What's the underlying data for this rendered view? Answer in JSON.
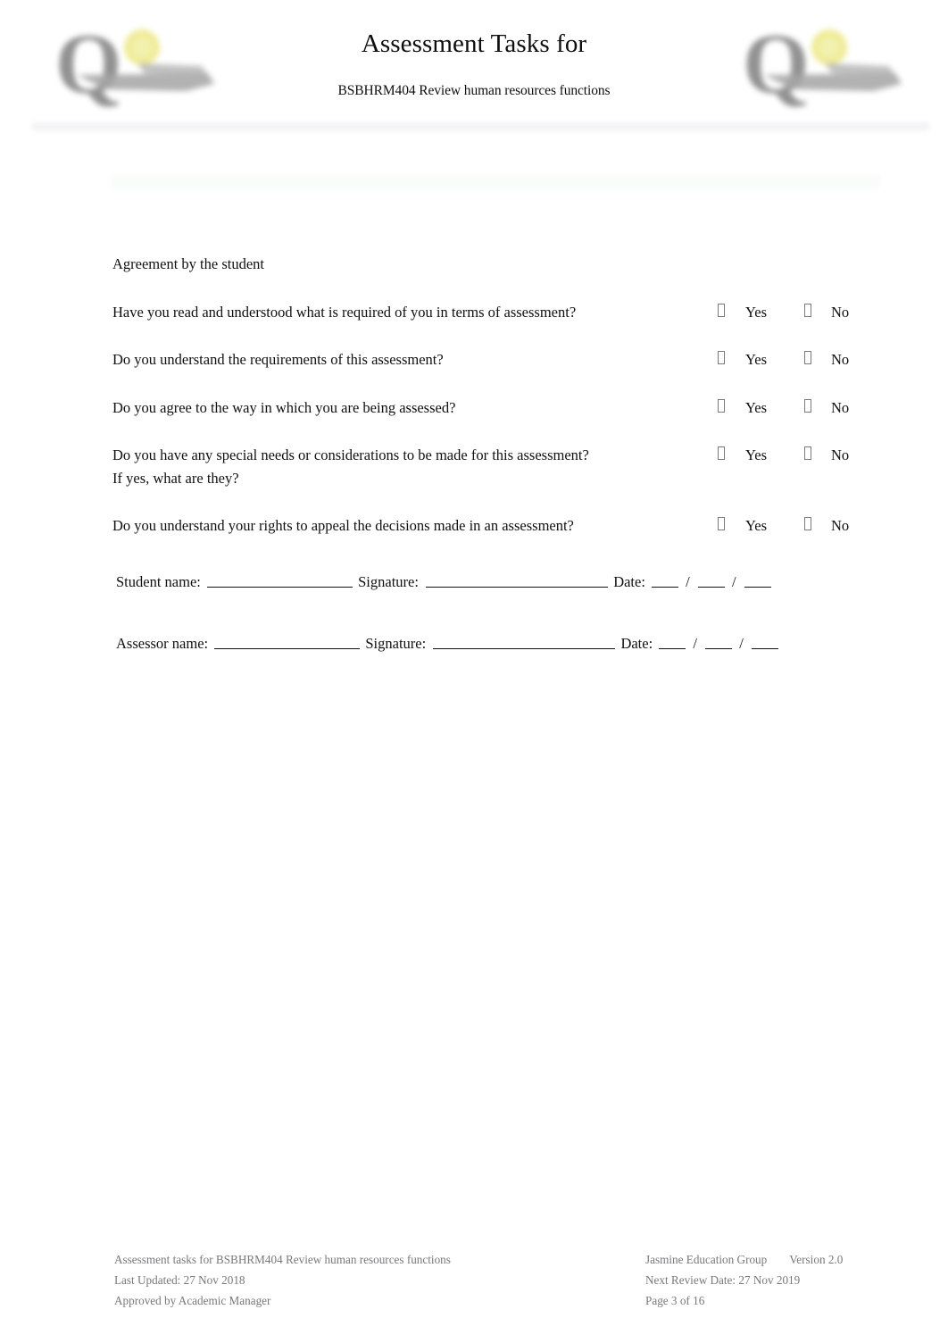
{
  "header": {
    "title": "Assessment Tasks for",
    "subtitle": "BSBHRM404 Review human resources functions",
    "logo_left_name": "jasmine-education-q-logo",
    "logo_right_name": "jasmine-education-q-logo"
  },
  "body": {
    "section_heading": "Agreement by the student",
    "questions": [
      {
        "line1": "Have you read and understood what is required of you in terms of assessment?",
        "line2": "",
        "yes_label": "Yes",
        "no_label": "No"
      },
      {
        "line1": "Do you understand the requirements of this assessment?",
        "line2": "",
        "yes_label": "Yes",
        "no_label": "No"
      },
      {
        "line1": "Do you agree to the way in which you are being assessed?",
        "line2": "",
        "yes_label": "Yes",
        "no_label": "No"
      },
      {
        "line1": "Do you have any special needs or considerations to be made for this assessment?",
        "line2": "If yes, what are they?",
        "yes_label": "Yes",
        "no_label": "No"
      },
      {
        "line1": "Do you understand your rights to appeal the decisions made in an assessment?",
        "line2": "",
        "yes_label": "Yes",
        "no_label": "No"
      }
    ],
    "signatures": [
      {
        "name_label": "Student name:",
        "signature_label": "Signature:",
        "date_label": "Date:",
        "date_separator": "/"
      },
      {
        "name_label": "Assessor name:",
        "signature_label": "Signature:",
        "date_label": "Date:",
        "date_separator": "/"
      }
    ]
  },
  "footer": {
    "left_line1": "Assessment tasks for  BSBHRM404 Review human resources functions",
    "left_line2": "Last Updated: 27 Nov 2018",
    "left_line3": "Approved  by Academic Manager",
    "right_org": "Jasmine Education Group",
    "right_version": "Version 2.0",
    "right_line2": "Next Review Date: 27 Nov 2019",
    "right_line3": "Page 3 of 16"
  }
}
